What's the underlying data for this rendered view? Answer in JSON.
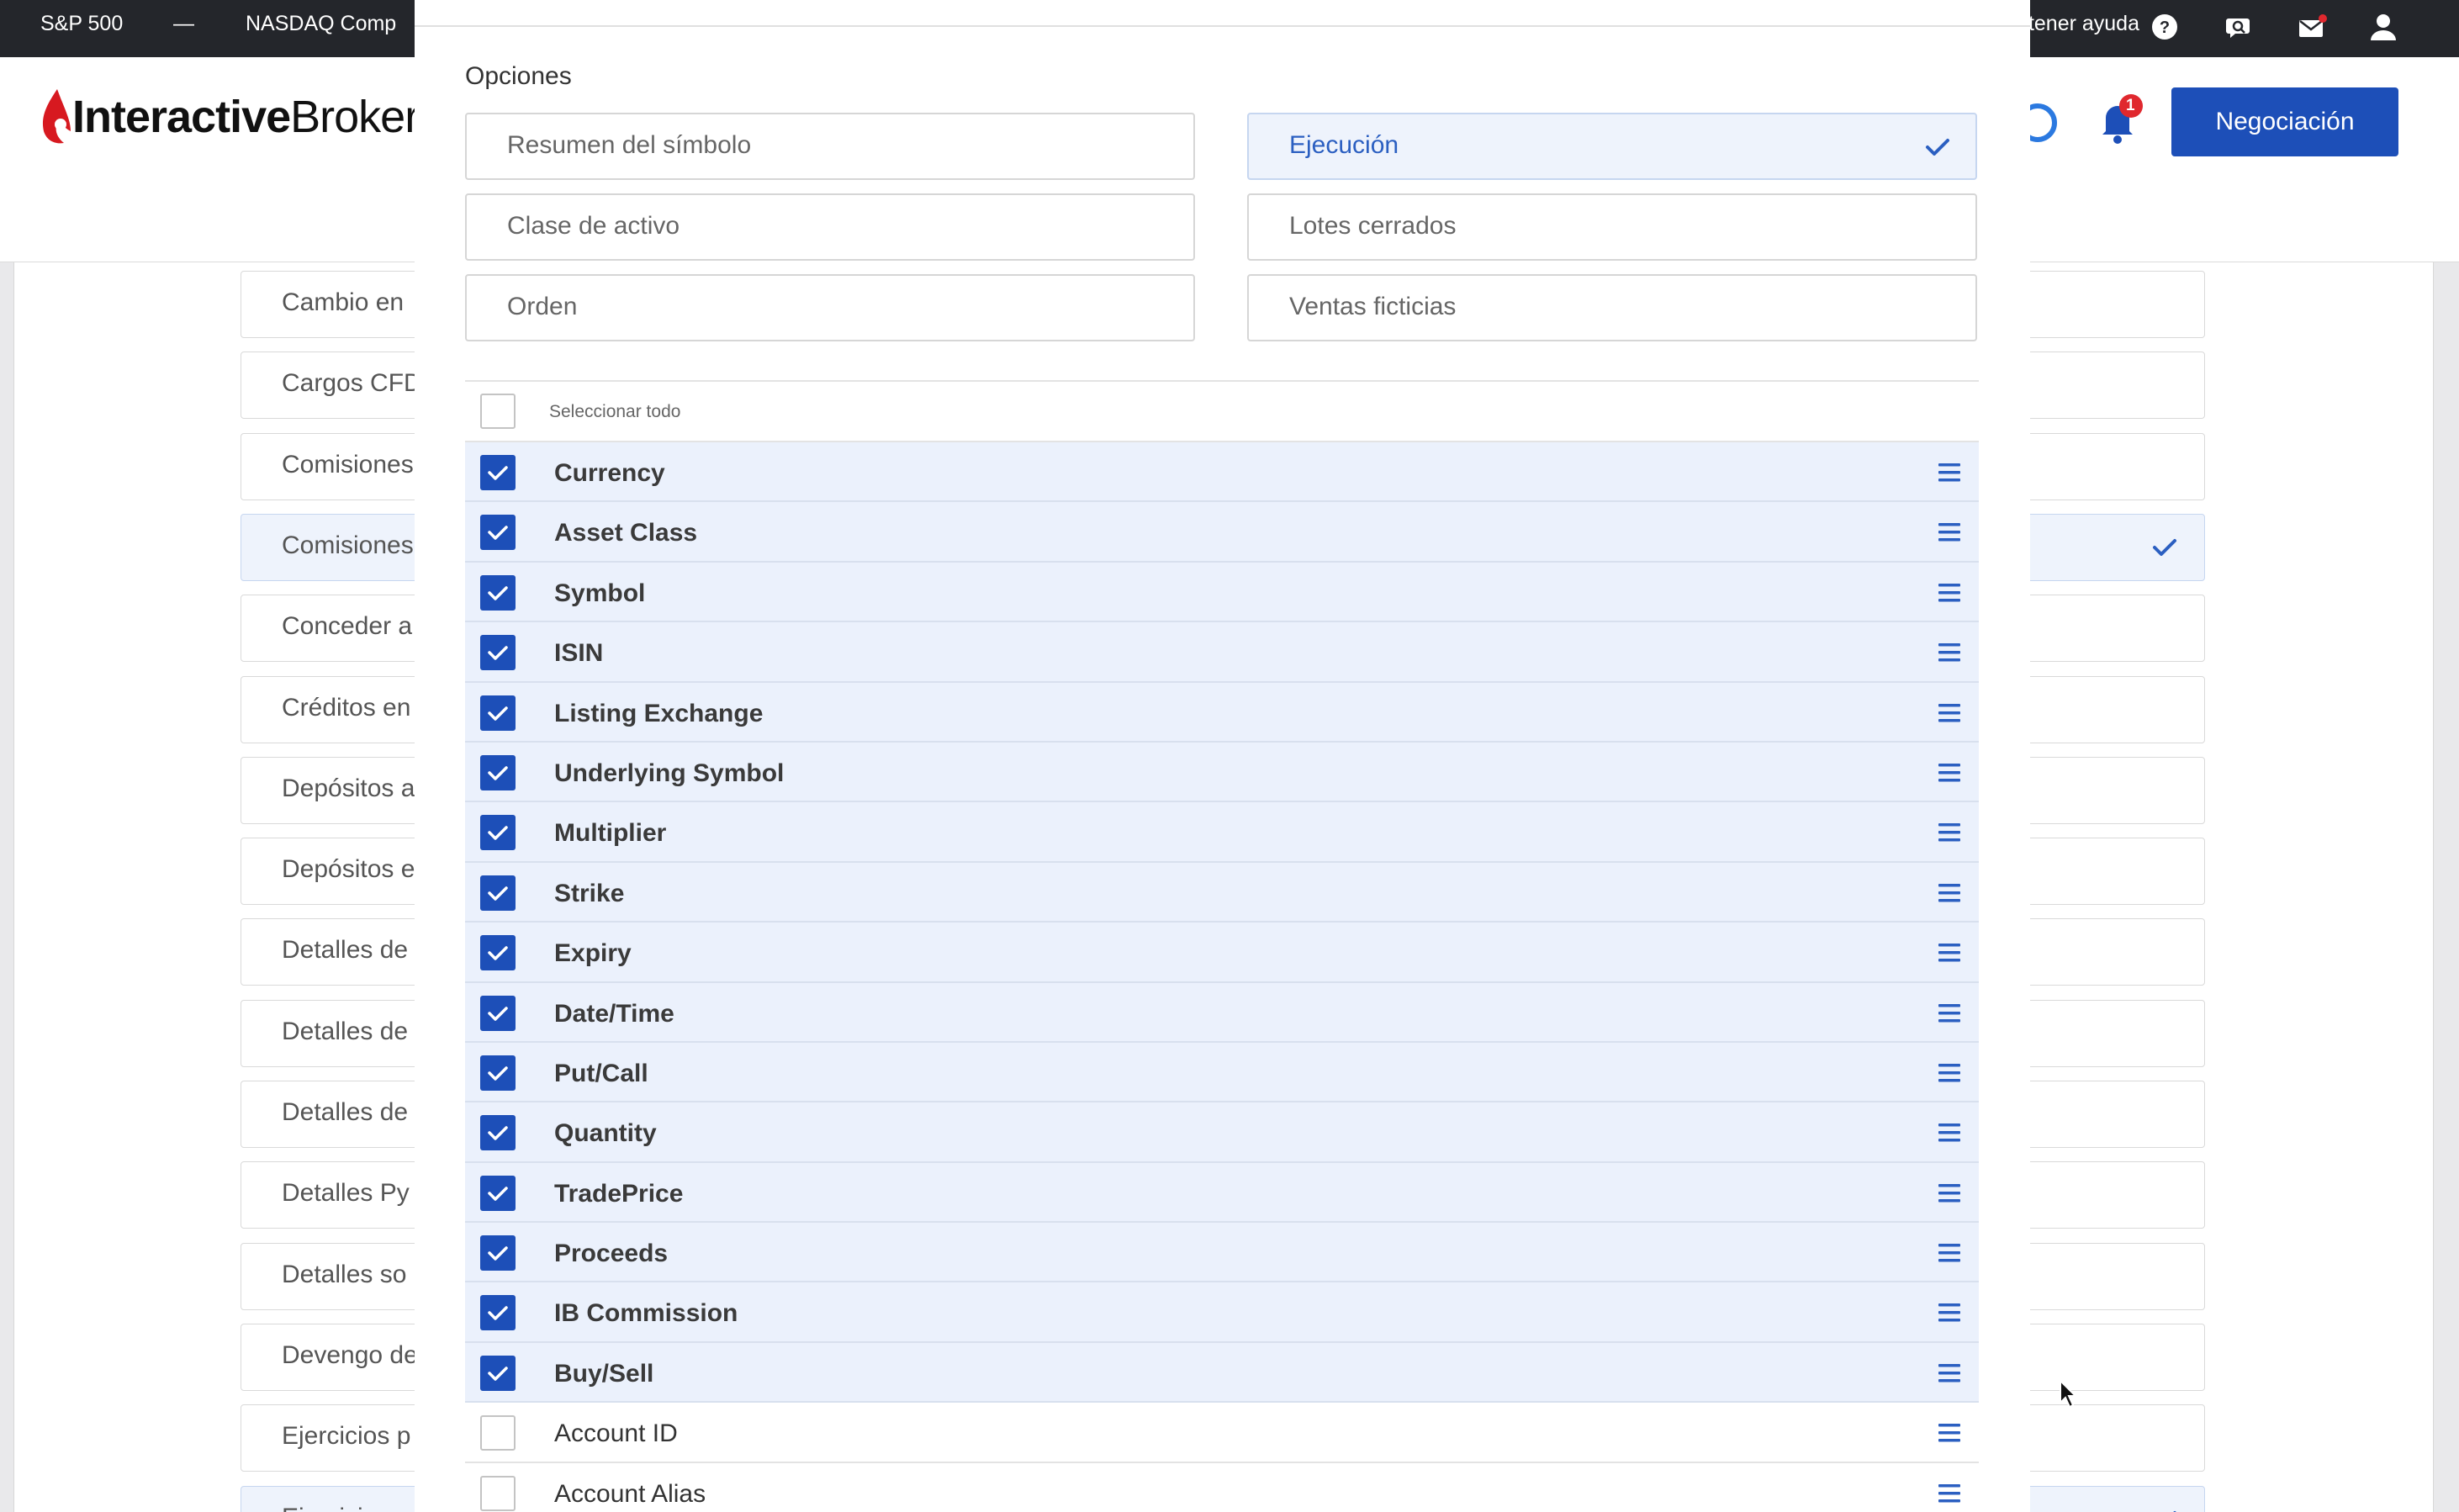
{
  "ticker": {
    "items": [
      {
        "label": "S&P 500"
      },
      {
        "label": "—"
      },
      {
        "label": "NASDAQ Comp"
      }
    ],
    "help_label": "Obtener ayuda"
  },
  "header": {
    "brand_bold": "Interactive",
    "brand_light": "Brokers",
    "notifications_count": "1",
    "trade_button": "Negociación"
  },
  "background_list": {
    "rows": [
      {
        "label": "Cambio en"
      },
      {
        "label": "Cargos CFD"
      },
      {
        "label": "Comisiones"
      },
      {
        "label": "Comisiones",
        "selected": true
      },
      {
        "label": "Conceder a"
      },
      {
        "label": "Créditos en"
      },
      {
        "label": "Depósitos a"
      },
      {
        "label": "Depósitos e"
      },
      {
        "label": "Detalles de"
      },
      {
        "label": "Detalles de"
      },
      {
        "label": "Detalles de"
      },
      {
        "label": "Detalles Py"
      },
      {
        "label": "Detalles so"
      },
      {
        "label": "Devengo de"
      },
      {
        "label": "Ejercicios p"
      },
      {
        "label": "Ejercicios",
        "selected": true
      }
    ]
  },
  "modal": {
    "options_title": "Opciones",
    "options": [
      {
        "label": "Resumen del símbolo",
        "selected": false
      },
      {
        "label": "Ejecución",
        "selected": true
      },
      {
        "label": "Clase de activo",
        "selected": false
      },
      {
        "label": "Lotes cerrados",
        "selected": false
      },
      {
        "label": "Orden",
        "selected": false
      },
      {
        "label": "Ventas ficticias",
        "selected": false
      }
    ],
    "select_all_label": "Seleccionar todo",
    "fields": [
      {
        "label": "Currency",
        "checked": true
      },
      {
        "label": "Asset Class",
        "checked": true
      },
      {
        "label": "Symbol",
        "checked": true
      },
      {
        "label": "ISIN",
        "checked": true
      },
      {
        "label": "Listing Exchange",
        "checked": true
      },
      {
        "label": "Underlying Symbol",
        "checked": true
      },
      {
        "label": "Multiplier",
        "checked": true
      },
      {
        "label": "Strike",
        "checked": true
      },
      {
        "label": "Expiry",
        "checked": true
      },
      {
        "label": "Date/Time",
        "checked": true
      },
      {
        "label": "Put/Call",
        "checked": true
      },
      {
        "label": "Quantity",
        "checked": true
      },
      {
        "label": "TradePrice",
        "checked": true
      },
      {
        "label": "Proceeds",
        "checked": true
      },
      {
        "label": "IB Commission",
        "checked": true
      },
      {
        "label": "Buy/Sell",
        "checked": true
      },
      {
        "label": "Account ID",
        "checked": false
      },
      {
        "label": "Account Alias",
        "checked": false
      }
    ]
  },
  "colors": {
    "accent": "#1d4fb8",
    "topbar": "#24262b",
    "selected_bg": "#eef3fc",
    "badge": "#e0282e"
  }
}
